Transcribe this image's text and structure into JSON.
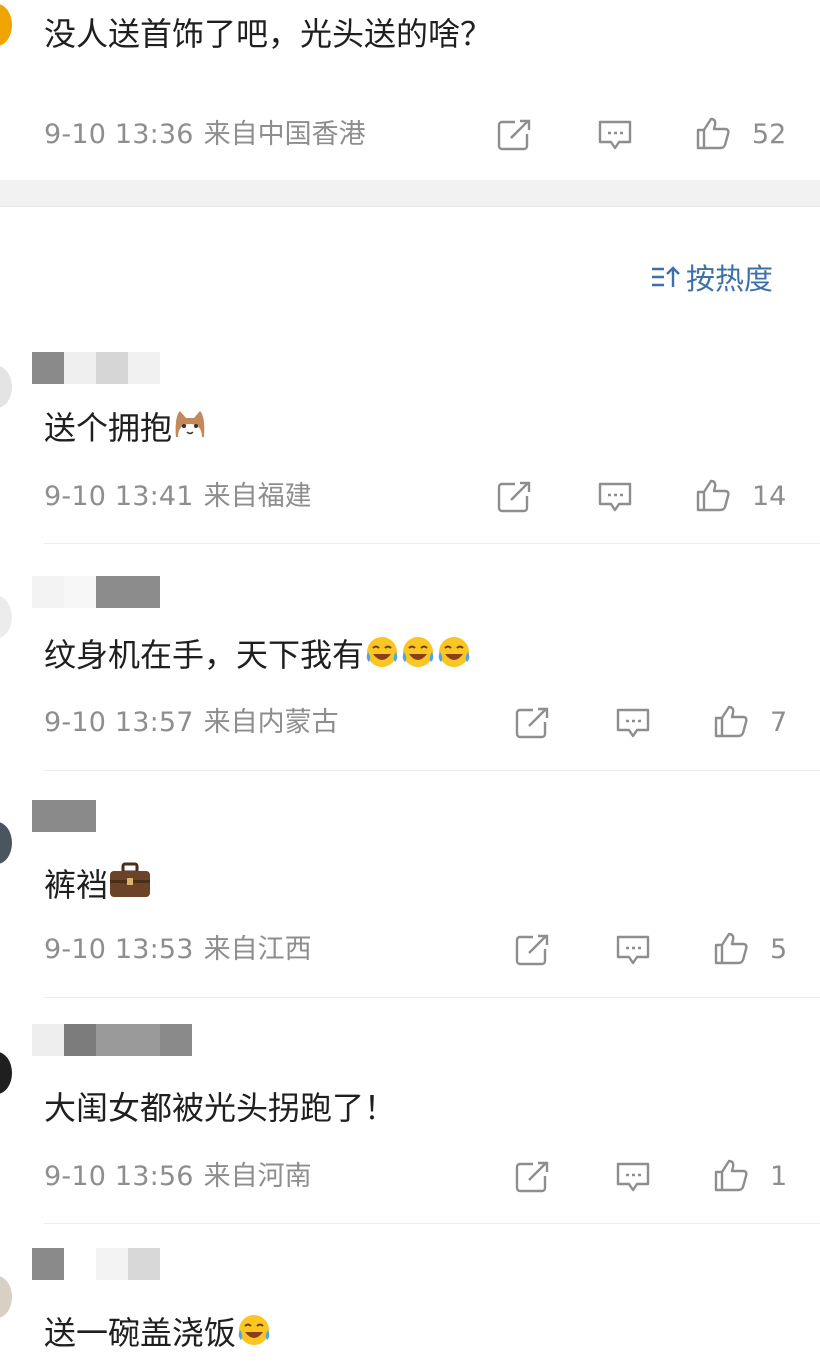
{
  "top_comment": {
    "text": "没人送首饰了吧，光头送的啥？",
    "time": "9-10 13:36",
    "location": "来自中国香港",
    "likes": "52"
  },
  "sort": {
    "label": "按热度",
    "icon": "sort-icon"
  },
  "replies": [
    {
      "text": "送个拥抱",
      "emoji": "cat-emoji",
      "time": "9-10 13:41",
      "location": "来自福建",
      "likes": "14"
    },
    {
      "text": "纹身机在手，天下我有",
      "emoji": "laugh-cry-emoji",
      "emoji_count": 3,
      "time": "9-10 13:57",
      "location": "来自内蒙古",
      "likes": "7"
    },
    {
      "text": "裤裆",
      "emoji": "briefcase-emoji",
      "time": "9-10 13:53",
      "location": "来自江西",
      "likes": "5"
    },
    {
      "text": "大闺女都被光头拐跑了！",
      "time": "9-10 13:56",
      "location": "来自河南",
      "likes": "1"
    },
    {
      "text": "送一碗盖浇饭",
      "emoji": "laugh-cry-emoji",
      "emoji_count": 1
    }
  ],
  "icons": {
    "share": "share-icon",
    "comment": "comment-icon",
    "like": "thumbs-up-icon"
  },
  "colors": {
    "meta": "#8e8e8e",
    "accent": "#3d6fa8",
    "text": "#1f1f1f"
  }
}
